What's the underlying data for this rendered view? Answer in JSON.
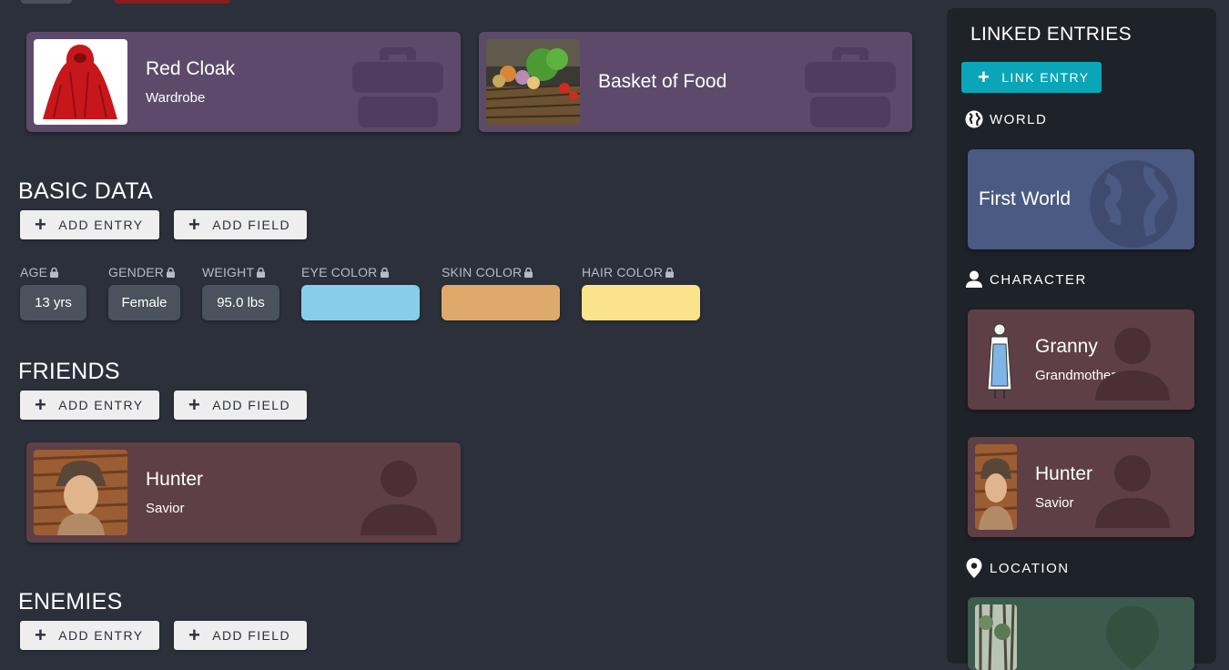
{
  "colors": {
    "background": "#2b303b",
    "item_card": "#5d4a6b",
    "person_card": "#5e3f46",
    "world_card": "#4b5a82",
    "location_card": "#3d5a4e",
    "accent": "#0aa6b8",
    "eye_color": "#87ceeb",
    "skin_color": "#deaa6a",
    "hair_color": "#fbe38b"
  },
  "items": [
    {
      "title": "Red Cloak",
      "subtitle": "Wardrobe",
      "icon": "briefcase-icon"
    },
    {
      "title": "Basket of Food",
      "subtitle": "",
      "icon": "briefcase-icon"
    }
  ],
  "basic_data": {
    "title": "BASIC DATA",
    "add_entry": "ADD ENTRY",
    "add_field": "ADD FIELD",
    "fields": [
      {
        "label": "AGE",
        "value": "13 yrs"
      },
      {
        "label": "GENDER",
        "value": "Female"
      },
      {
        "label": "WEIGHT",
        "value": "95.0 lbs"
      },
      {
        "label": "EYE COLOR",
        "value": ""
      },
      {
        "label": "SKIN COLOR",
        "value": ""
      },
      {
        "label": "HAIR COLOR",
        "value": ""
      }
    ]
  },
  "friends": {
    "title": "FRIENDS",
    "add_entry": "ADD ENTRY",
    "add_field": "ADD FIELD",
    "entries": [
      {
        "title": "Hunter",
        "subtitle": "Savior",
        "icon": "person-icon"
      }
    ]
  },
  "enemies": {
    "title": "ENEMIES",
    "add_entry": "ADD ENTRY",
    "add_field": "ADD FIELD"
  },
  "linked": {
    "title": "LINKED ENTRIES",
    "link_button": "LINK ENTRY",
    "world_label": "WORLD",
    "world_entry": {
      "title": "First World"
    },
    "character_label": "CHARACTER",
    "characters": [
      {
        "title": "Granny",
        "subtitle": "Grandmother"
      },
      {
        "title": "Hunter",
        "subtitle": "Savior"
      }
    ],
    "location_label": "LOCATION"
  }
}
